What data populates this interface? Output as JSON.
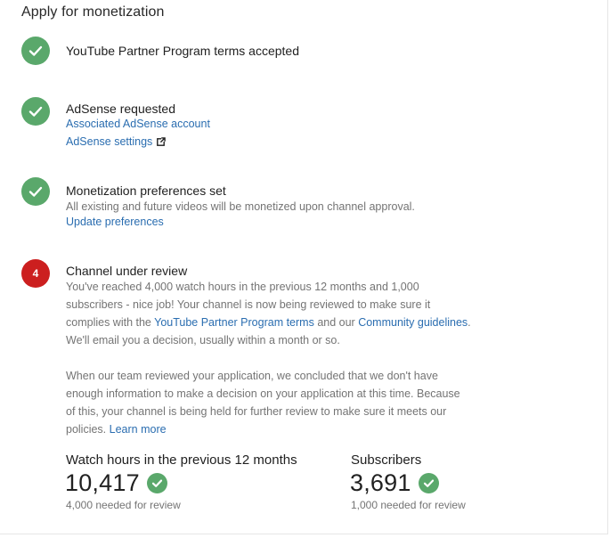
{
  "page": {
    "title": "Apply for monetization"
  },
  "steps": [
    {
      "status": "done",
      "title": "YouTube Partner Program terms accepted"
    },
    {
      "status": "done",
      "title": "AdSense requested",
      "links": [
        "Associated AdSense account",
        "AdSense settings"
      ]
    },
    {
      "status": "done",
      "title": "Monetization preferences set",
      "description": "All existing and future videos will be monetized upon channel approval.",
      "link": "Update preferences"
    },
    {
      "status": "in-review",
      "number": "4",
      "title": "Channel under review",
      "para1": {
        "line1": "You've reached 4,000 watch hours in the previous 12 months and 1,000",
        "line2": "subscribers - nice job! Your channel is now being reviewed to make sure it",
        "line3_a": "complies with the ",
        "line3_link1": "YouTube Partner Program terms",
        "line3_b": " and our ",
        "line3_link2": "Community guidelines",
        "line3_c": ".",
        "line4": "We'll email you a decision, usually within a month or so."
      },
      "para2": {
        "line1": "When our team reviewed your application, we concluded that we don't have",
        "line2": "enough information to make a decision on your application at this time. Because",
        "line3": "of this, your channel is being held for further review to make sure it meets our",
        "line4_a": "policies. ",
        "line4_link": "Learn more"
      }
    }
  ],
  "metrics": {
    "watch_hours": {
      "label": "Watch hours in the previous 12 months",
      "value": "10,417",
      "requirement": "4,000 needed for review"
    },
    "subscribers": {
      "label": "Subscribers",
      "value": "3,691",
      "requirement": "1,000 needed for review"
    }
  },
  "icons": {
    "check": "check-icon",
    "external": "external-link-icon"
  },
  "colors": {
    "success": "#5aa86b",
    "pending": "#cc1f1f",
    "link": "#2a6db0",
    "muted": "#747474"
  }
}
